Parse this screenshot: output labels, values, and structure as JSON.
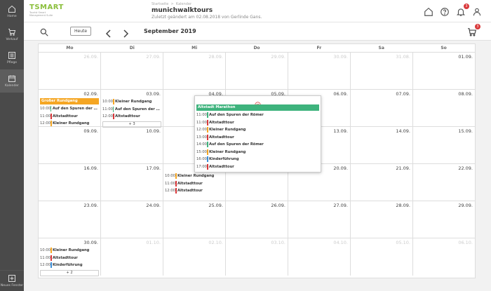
{
  "colors": {
    "green": "#3eb37d",
    "orange": "#f5a623",
    "red": "#d9383a",
    "blue": "#3b8fd9",
    "rail": "#4a4a4a"
  },
  "app": {
    "logo_text": "TSMART",
    "logo_sub": "Tourist Smart Management Suite"
  },
  "rail": {
    "items": [
      {
        "label": "Home",
        "icon": "house-icon"
      },
      {
        "label": "Verkauf",
        "icon": "cart-icon"
      },
      {
        "label": "Pflege",
        "icon": "list-icon"
      },
      {
        "label": "Kalender",
        "icon": "calendar-icon"
      }
    ],
    "bottom_label": "Neues Fenster"
  },
  "header": {
    "breadcrumb_1": "Startseite",
    "breadcrumb_sep": ">",
    "breadcrumb_2": "Kalender",
    "title": "munichwalktours",
    "subtitle": "Zuletzt geändert am 02.08.2018 von Gerlinde Gans.",
    "notifications_count": "3"
  },
  "toolbar": {
    "today_label": "Heute",
    "month_label": "September 2019",
    "cart_count": "3"
  },
  "weekdays": [
    "Mo",
    "Di",
    "Mi",
    "Do",
    "Fr",
    "Sa",
    "So"
  ],
  "weeks": [
    [
      {
        "num": "26.09.",
        "muted": true
      },
      {
        "num": "27.09.",
        "muted": true
      },
      {
        "num": "28.09.",
        "muted": true
      },
      {
        "num": "29.09.",
        "muted": true
      },
      {
        "num": "30.09.",
        "muted": true
      },
      {
        "num": "31.08.",
        "muted": true
      },
      {
        "num": "01.09."
      }
    ],
    [
      {
        "num": "02.09.",
        "block": {
          "title": "Großer Rundgang",
          "color": "#f5a623"
        },
        "events": [
          {
            "time": "10:00",
            "title": "Auf den Spuren der Rö...",
            "color": "#3eb37d"
          },
          {
            "time": "11:00",
            "title": "Altstadttour",
            "color": "#d9383a"
          },
          {
            "time": "12:00",
            "title": "Kleiner Rundgang",
            "color": "#f5a623"
          }
        ]
      },
      {
        "num": "03.09.",
        "events": [
          {
            "time": "10:00",
            "title": "Kleiner Rundgang",
            "color": "#f5a623"
          },
          {
            "time": "11:00",
            "title": "Auf den Spuren der Rö...",
            "color": "#3eb37d"
          },
          {
            "time": "12:00",
            "title": "Altstadttour",
            "color": "#d9383a"
          }
        ],
        "more": "+ 3"
      },
      {
        "num": "04.09."
      },
      {
        "num": "05.09."
      },
      {
        "num": "06.09."
      },
      {
        "num": "07.09."
      },
      {
        "num": "08.09."
      }
    ],
    [
      {
        "num": "09.09."
      },
      {
        "num": "10.09."
      },
      {
        "num": "11.09."
      },
      {
        "num": "12.09."
      },
      {
        "num": "13.09."
      },
      {
        "num": "14.09."
      },
      {
        "num": "15.09."
      }
    ],
    [
      {
        "num": "16.09."
      },
      {
        "num": "17.09."
      },
      {
        "num": "18.09.",
        "accent": true,
        "events": [
          {
            "time": "10:00",
            "title": "Kleiner Rundgang",
            "color": "#f5a623"
          },
          {
            "time": "11:00",
            "title": "Altstadttour",
            "color": "#d9383a"
          },
          {
            "time": "12:00",
            "title": "Altstadttour",
            "color": "#d9383a"
          }
        ]
      },
      {
        "num": "19.09."
      },
      {
        "num": "20.09."
      },
      {
        "num": "21.09."
      },
      {
        "num": "22.09."
      }
    ],
    [
      {
        "num": "23.09."
      },
      {
        "num": "24.09."
      },
      {
        "num": "25.09."
      },
      {
        "num": "26.09."
      },
      {
        "num": "27.09."
      },
      {
        "num": "28.09."
      },
      {
        "num": "29.09."
      }
    ],
    [
      {
        "num": "30.09.",
        "events": [
          {
            "time": "10:00",
            "title": "Kleiner Rundgang",
            "color": "#f5a623"
          },
          {
            "time": "11:00",
            "title": "Altstadttour",
            "color": "#d9383a"
          },
          {
            "time": "12:00",
            "title": "Kinderführung",
            "color": "#3b8fd9"
          }
        ],
        "more": "+ 2"
      },
      {
        "num": "01.10.",
        "muted": true
      },
      {
        "num": "02.10.",
        "muted": true
      },
      {
        "num": "03.10.",
        "muted": true
      },
      {
        "num": "04.10.",
        "muted": true
      },
      {
        "num": "05.10.",
        "muted": true
      },
      {
        "num": "06.10.",
        "muted": true
      }
    ]
  ],
  "popover": {
    "block": {
      "title": "Altstadt Marathon",
      "color": "#3eb37d"
    },
    "events": [
      {
        "time": "11:00",
        "title": "Auf den Spuren der Römer",
        "color": "#3eb37d"
      },
      {
        "time": "11:00",
        "title": "Altstadttour",
        "color": "#d9383a"
      },
      {
        "time": "12:00",
        "title": "Kleiner Rundgang",
        "color": "#f5a623"
      },
      {
        "time": "13:00",
        "title": "Altstadttour",
        "color": "#d9383a"
      },
      {
        "time": "14:00",
        "title": "Auf den Spuren der Römer",
        "color": "#3eb37d"
      },
      {
        "time": "15:00",
        "title": "Kleiner Rundgang",
        "color": "#f5a623"
      },
      {
        "time": "16:00",
        "title": "Kinderführung",
        "color": "#3b8fd9"
      },
      {
        "time": "17:00",
        "title": "Altstadttour",
        "color": "#d9383a"
      }
    ]
  }
}
